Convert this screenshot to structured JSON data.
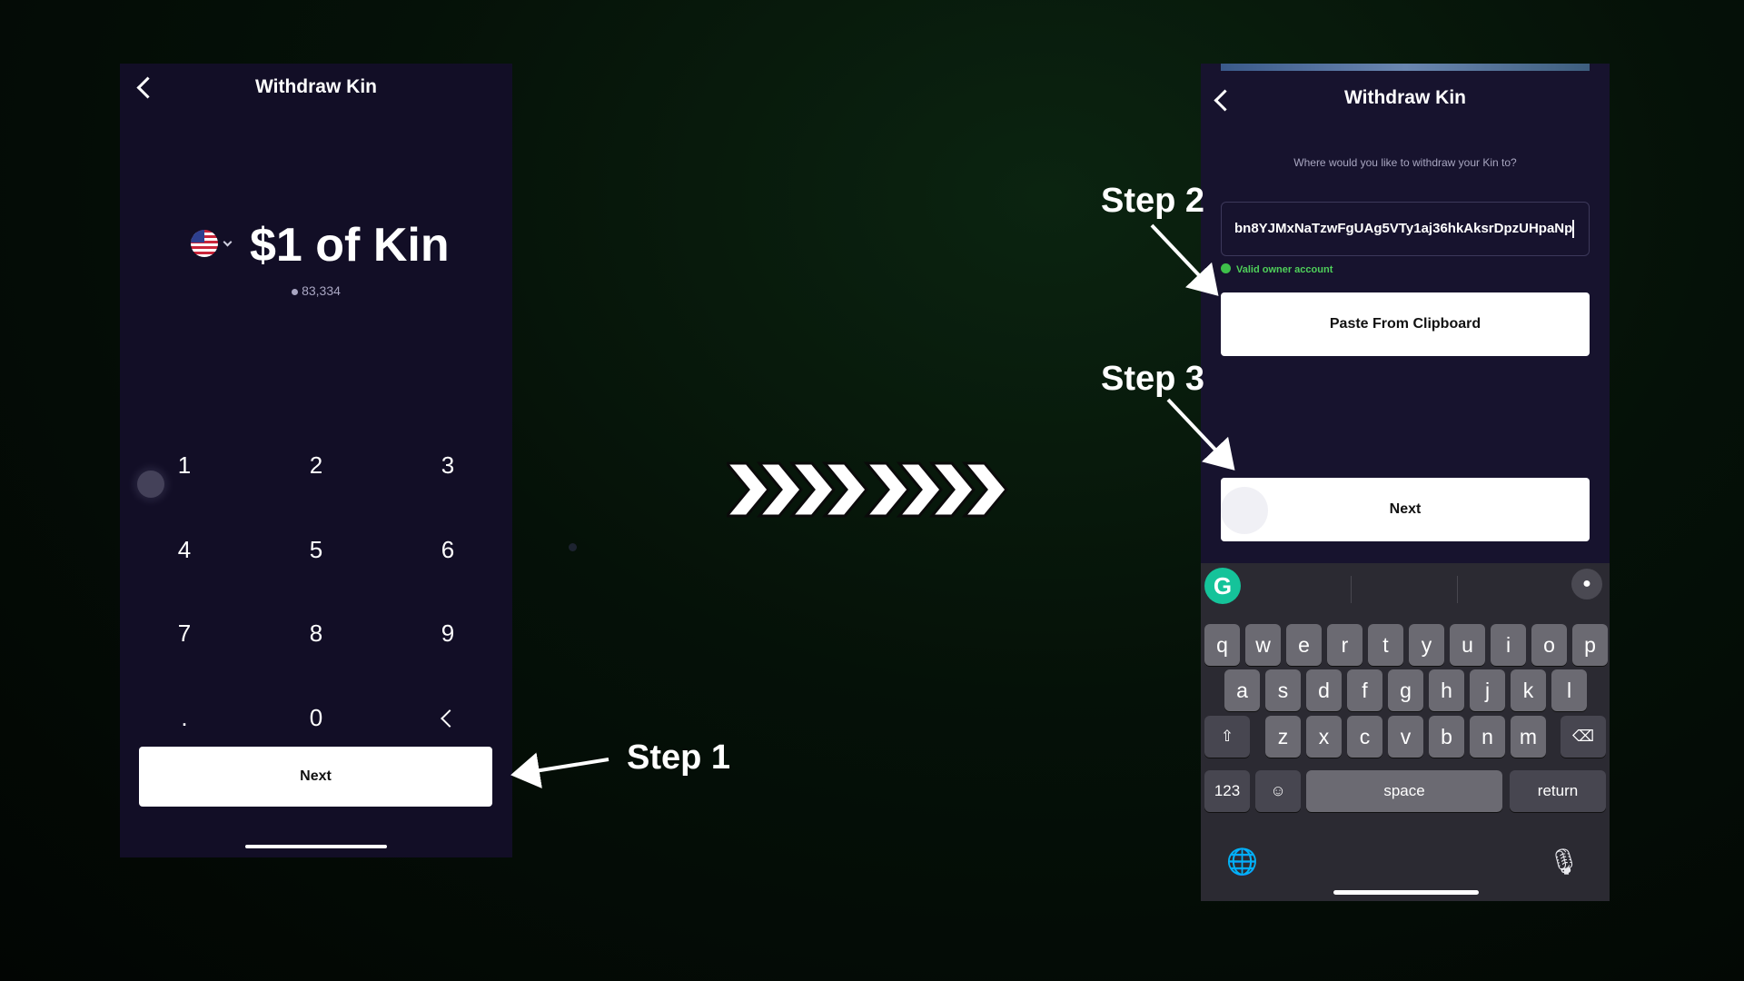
{
  "left_screen": {
    "title": "Withdraw Kin",
    "amount": "$1 of Kin",
    "kin_amount": "83,334",
    "keypad": [
      "1",
      "2",
      "3",
      "4",
      "5",
      "6",
      "7",
      "8",
      "9",
      ".",
      "0"
    ],
    "next_label": "Next"
  },
  "right_screen": {
    "title": "Withdraw Kin",
    "question": "Where would you like to withdraw your Kin to?",
    "address_value": "bn8YJMxNaTzwFgUAg5VTy1aj36hkAksrDpzUHpaNp",
    "validation": "Valid owner account",
    "paste_label": "Paste From Clipboard",
    "next_label": "Next",
    "keyboard": {
      "row1": [
        "q",
        "w",
        "e",
        "r",
        "t",
        "y",
        "u",
        "i",
        "o",
        "p"
      ],
      "row2": [
        "a",
        "s",
        "d",
        "f",
        "g",
        "h",
        "j",
        "k",
        "l"
      ],
      "row3": [
        "z",
        "x",
        "c",
        "v",
        "b",
        "n",
        "m"
      ],
      "numbers_key": "123",
      "space_key": "space",
      "return_key": "return"
    }
  },
  "annotations": {
    "step1": "Step 1",
    "step2": "Step 2",
    "step3": "Step 3"
  },
  "icons": {
    "back": "chevron-left-icon",
    "flag": "us-flag-icon",
    "emoji": "emoji-icon",
    "globe": "globe-icon",
    "mic": "microphone-icon",
    "shift": "shift-icon",
    "delete": "backspace-icon",
    "grammarly": "grammarly-icon"
  }
}
